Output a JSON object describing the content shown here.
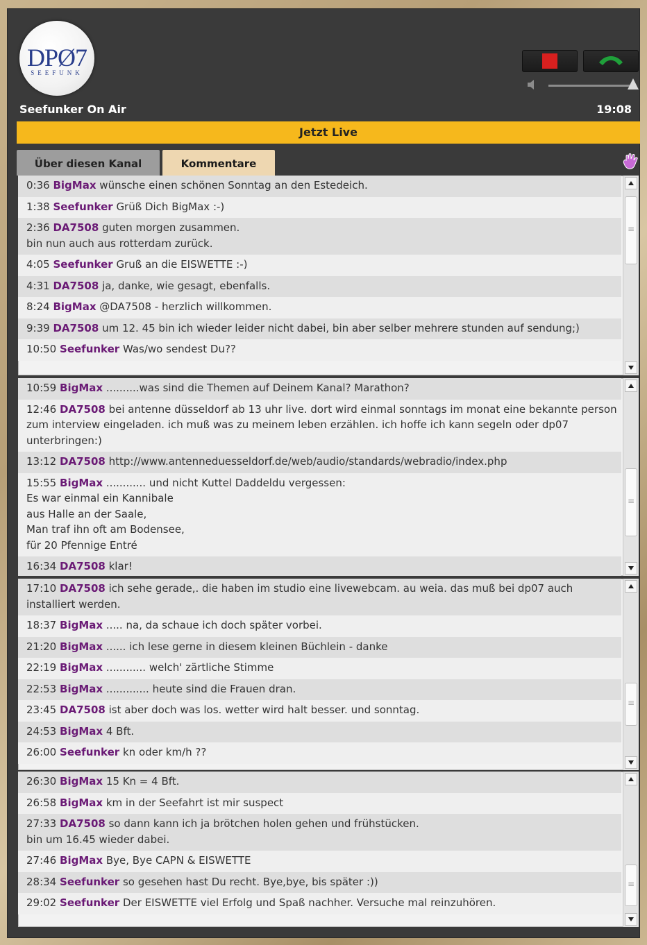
{
  "logo": {
    "main": "DPØ7",
    "sub": "SEEFUNK"
  },
  "station": "Seefunker On Air",
  "clock": "19:08",
  "live_label": "Jetzt Live",
  "tabs": [
    {
      "label": "Über diesen Kanal",
      "active": false
    },
    {
      "label": "Kommentare",
      "active": true
    }
  ],
  "icons": {
    "stop": "stop-icon",
    "call": "phone-icon",
    "volume": "speaker-icon",
    "reaction": "hand-icon"
  },
  "colors": {
    "live_bar": "#f6b81c",
    "username": "#6a1a75",
    "stop": "#d8201f",
    "call": "#1fa03a"
  },
  "panels": [
    {
      "messages": [
        {
          "time": "0:36",
          "user": "BigMax",
          "text": "wünsche einen schönen Sonntag an den Estedeich."
        },
        {
          "time": "1:38",
          "user": "Seefunker",
          "text": "Grüß Dich BigMax :-)"
        },
        {
          "time": "2:36",
          "user": "DA7508",
          "text": "guten morgen zusammen.\nbin nun auch aus rotterdam zurück."
        },
        {
          "time": "4:05",
          "user": "Seefunker",
          "text": "Gruß an die EISWETTE :-)"
        },
        {
          "time": "4:31",
          "user": "DA7508",
          "text": "ja, danke, wie gesagt, ebenfalls."
        },
        {
          "time": "8:24",
          "user": "BigMax",
          "text": "@DA7508 - herzlich willkommen."
        },
        {
          "time": "9:39",
          "user": "DA7508",
          "text": "um 12. 45 bin ich wieder leider nicht dabei, bin aber selber mehrere stunden auf sendung;)"
        },
        {
          "time": "10:50",
          "user": "Seefunker",
          "text": "Was/wo sendest Du??"
        }
      ]
    },
    {
      "messages": [
        {
          "time": "10:59",
          "user": "BigMax",
          "text": "..........was sind die Themen auf Deinem Kanal? Marathon?"
        },
        {
          "time": "12:46",
          "user": "DA7508",
          "text": "bei antenne düsseldorf ab 13 uhr live. dort wird einmal sonntags im monat eine bekannte person zum interview eingeladen. ich muß was zu meinem leben erzählen. ich hoffe ich kann segeln oder dp07 unterbringen:)"
        },
        {
          "time": "13:12",
          "user": "DA7508",
          "text": "http://www.antenneduesseldorf.de/web/audio/standards/webradio/index.php"
        },
        {
          "time": "15:55",
          "user": "BigMax",
          "text": "............ und nicht Kuttel Daddeldu vergessen:\nEs war einmal ein Kannibale\naus Halle an der Saale,\nMan traf ihn oft am Bodensee,\nfür 20 Pfennige Entré"
        },
        {
          "time": "16:34",
          "user": "DA7508",
          "text": "klar!"
        }
      ]
    },
    {
      "messages": [
        {
          "time": "17:10",
          "user": "DA7508",
          "text": "ich sehe gerade,. die haben im studio eine livewebcam. au weia. das muß bei dp07 auch installiert werden."
        },
        {
          "time": "18:37",
          "user": "BigMax",
          "text": "..... na, da schaue ich doch später vorbei."
        },
        {
          "time": "21:20",
          "user": "BigMax",
          "text": "...... ich lese gerne in diesem kleinen Büchlein - danke"
        },
        {
          "time": "22:19",
          "user": "BigMax",
          "text": "............ welch' zärtliche Stimme"
        },
        {
          "time": "22:53",
          "user": "BigMax",
          "text": "............. heute sind die Frauen dran."
        },
        {
          "time": "23:45",
          "user": "DA7508",
          "text": "ist aber doch was los. wetter wird halt besser. und sonntag."
        },
        {
          "time": "24:53",
          "user": "BigMax",
          "text": "4 Bft."
        },
        {
          "time": "26:00",
          "user": "Seefunker",
          "text": "kn oder km/h ??"
        }
      ]
    },
    {
      "messages": [
        {
          "time": "26:30",
          "user": "BigMax",
          "text": "15 Kn = 4 Bft."
        },
        {
          "time": "26:58",
          "user": "BigMax",
          "text": "km in der Seefahrt ist mir suspect"
        },
        {
          "time": "27:33",
          "user": "DA7508",
          "text": "so dann kann ich ja brötchen holen gehen und frühstücken.\nbin um 16.45 wieder dabei."
        },
        {
          "time": "27:46",
          "user": "BigMax",
          "text": "Bye, Bye CAPN & EISWETTE"
        },
        {
          "time": "28:34",
          "user": "Seefunker",
          "text": "so gesehen hast Du recht. Bye,bye, bis später :))"
        },
        {
          "time": "29:02",
          "user": "Seefunker",
          "text": "Der EISWETTE viel Erfolg und Spaß nachher. Versuche mal reinzuhören."
        }
      ]
    }
  ]
}
